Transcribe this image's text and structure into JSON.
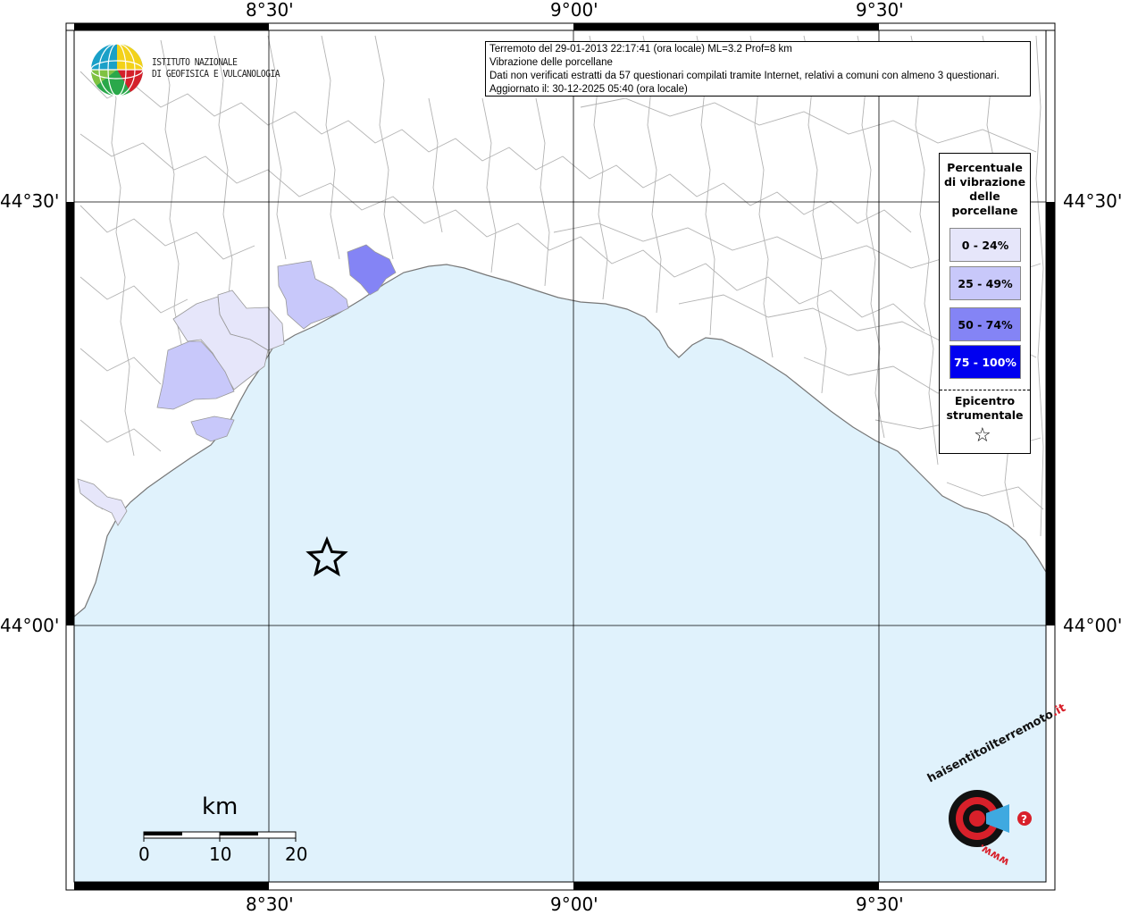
{
  "axes": {
    "top": [
      "8°30'",
      "9°00'",
      "9°30'"
    ],
    "bottom": [
      "8°30'",
      "9°00'",
      "9°30'"
    ],
    "left": [
      "44°30'",
      "44°00'"
    ],
    "right": [
      "44°30'",
      "44°00'"
    ]
  },
  "info": {
    "line1": "Terremoto del 29-01-2013 22:17:41 (ora locale) ML=3.2 Prof=8 km",
    "line2": "Vibrazione delle porcellane",
    "line3": "Dati non verificati estratti da 57 questionari compilati tramite Internet, relativi a comuni con almeno 3 questionari.",
    "line4": "Aggiornato il: 30-12-2025 05:40 (ora locale)"
  },
  "logo": {
    "line1": "ISTITUTO NAZIONALE",
    "line2": "DI GEOFISICA E VULCANOLOGIA"
  },
  "legend": {
    "title_lines": [
      "Percentuale",
      "di vibrazione",
      "delle",
      "porcellane"
    ],
    "classes": [
      {
        "label": "0 - 24%",
        "color": "#e6e6fa"
      },
      {
        "label": "25 - 49%",
        "color": "#c8c8fa"
      },
      {
        "label": "50 - 74%",
        "color": "#8484f5"
      },
      {
        "label": "75 - 100%",
        "color": "#0000f0"
      }
    ],
    "epicenter_lines": [
      "Epicentro",
      "strumentale"
    ],
    "epicenter_symbol": "☆"
  },
  "scale": {
    "unit": "km",
    "ticks": [
      "0",
      "10",
      "20"
    ]
  },
  "hsit_logo": {
    "text_main": "haisentitoilterremoto",
    "text_tld": ".it",
    "text_www": "www."
  },
  "colors": {
    "sea": "#e0f2fc",
    "land": "#ffffff",
    "borders": "#aaaaaa",
    "grid": "#000000"
  }
}
